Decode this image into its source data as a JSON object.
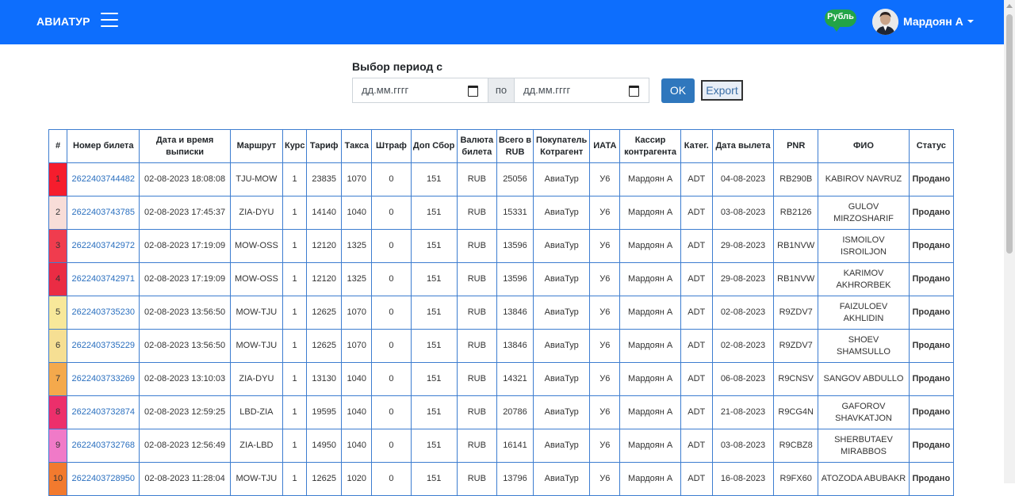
{
  "navbar": {
    "brand": "АВИАТУР",
    "currency": "Рубль",
    "user_name": "Мардоян А"
  },
  "filter": {
    "label": "Выбор период с",
    "from_placeholder": "дд.мм.гггг",
    "separator": "по",
    "to_placeholder": "дд.мм.гггг",
    "ok_label": "OK",
    "export_label": "Export"
  },
  "table": {
    "headers": [
      "#",
      "Номер билета",
      "Дата и время выписки",
      "Маршрут",
      "Курс",
      "Тариф",
      "Такса",
      "Штраф",
      "Доп Сбор",
      "Валюта билета",
      "Всего в RUB",
      "Покупатель Котрагент",
      "ИАТА",
      "Кассир контрагента",
      "Катег.",
      "Дата вылета",
      "PNR",
      "ФИО",
      "Статус"
    ],
    "rows": [
      {
        "num": "1",
        "color": "#f51d2d",
        "ticket": "2622403744482",
        "issued": "02-08-2023 18:08:08",
        "route": "TJU-MOW",
        "course": "1",
        "fare": "23835",
        "tax": "1070",
        "fine": "0",
        "extra": "151",
        "currency": "RUB",
        "total": "25056",
        "buyer": "АвиаТур",
        "iata": "У6",
        "cashier": "Мардоян А",
        "category": "ADT",
        "departure": "04-08-2023",
        "pnr": "RB290B",
        "name": "KABIROV NAVRUZ",
        "status": "Продано"
      },
      {
        "num": "2",
        "color": "#f8ddd8",
        "ticket": "2622403743785",
        "issued": "02-08-2023 17:45:37",
        "route": "ZIA-DYU",
        "course": "1",
        "fare": "14140",
        "tax": "1040",
        "fine": "0",
        "extra": "151",
        "currency": "RUB",
        "total": "15331",
        "buyer": "АвиаТур",
        "iata": "У6",
        "cashier": "Мардоян А",
        "category": "ADT",
        "departure": "03-08-2023",
        "pnr": "RB2126",
        "name": "GULOV MIRZOSHARIF",
        "status": "Продано"
      },
      {
        "num": "3",
        "color": "#f03c4e",
        "ticket": "2622403742972",
        "issued": "02-08-2023 17:19:09",
        "route": "MOW-OSS",
        "course": "1",
        "fare": "12120",
        "tax": "1325",
        "fine": "0",
        "extra": "151",
        "currency": "RUB",
        "total": "13596",
        "buyer": "АвиаТур",
        "iata": "У6",
        "cashier": "Мардоян А",
        "category": "ADT",
        "departure": "29-08-2023",
        "pnr": "RB1NVW",
        "name": "ISMOILOV ISROILJON",
        "status": "Продано"
      },
      {
        "num": "4",
        "color": "#ea2c44",
        "ticket": "2622403742971",
        "issued": "02-08-2023 17:19:09",
        "route": "MOW-OSS",
        "course": "1",
        "fare": "12120",
        "tax": "1325",
        "fine": "0",
        "extra": "151",
        "currency": "RUB",
        "total": "13596",
        "buyer": "АвиаТур",
        "iata": "У6",
        "cashier": "Мардоян А",
        "category": "ADT",
        "departure": "29-08-2023",
        "pnr": "RB1NVW",
        "name": "KARIMOV AKHRORBEK",
        "status": "Продано"
      },
      {
        "num": "5",
        "color": "#f8e89a",
        "ticket": "2622403735230",
        "issued": "02-08-2023 13:56:50",
        "route": "MOW-TJU",
        "course": "1",
        "fare": "12625",
        "tax": "1070",
        "fine": "0",
        "extra": "151",
        "currency": "RUB",
        "total": "13846",
        "buyer": "АвиаТур",
        "iata": "У6",
        "cashier": "Мардоян А",
        "category": "ADT",
        "departure": "02-08-2023",
        "pnr": "R9ZDV7",
        "name": "FAIZULOEV AKHLIDIN",
        "status": "Продано"
      },
      {
        "num": "6",
        "color": "#f6df93",
        "ticket": "2622403735229",
        "issued": "02-08-2023 13:56:50",
        "route": "MOW-TJU",
        "course": "1",
        "fare": "12625",
        "tax": "1070",
        "fine": "0",
        "extra": "151",
        "currency": "RUB",
        "total": "13846",
        "buyer": "АвиаТур",
        "iata": "У6",
        "cashier": "Мардоян А",
        "category": "ADT",
        "departure": "02-08-2023",
        "pnr": "R9ZDV7",
        "name": "SHOEV SHAMSULLO",
        "status": "Продано"
      },
      {
        "num": "7",
        "color": "#f4a94c",
        "ticket": "2622403733269",
        "issued": "02-08-2023 13:10:03",
        "route": "ZIA-DYU",
        "course": "1",
        "fare": "13130",
        "tax": "1040",
        "fine": "0",
        "extra": "151",
        "currency": "RUB",
        "total": "14321",
        "buyer": "АвиаТур",
        "iata": "У6",
        "cashier": "Мардоян А",
        "category": "ADT",
        "departure": "06-08-2023",
        "pnr": "R9CNSV",
        "name": "SANGOV ABDULLO",
        "status": "Продано"
      },
      {
        "num": "8",
        "color": "#ec2f6b",
        "ticket": "2622403732874",
        "issued": "02-08-2023 12:59:25",
        "route": "LBD-ZIA",
        "course": "1",
        "fare": "19595",
        "tax": "1040",
        "fine": "0",
        "extra": "151",
        "currency": "RUB",
        "total": "20786",
        "buyer": "АвиаТур",
        "iata": "У6",
        "cashier": "Мардоян А",
        "category": "ADT",
        "departure": "21-08-2023",
        "pnr": "R9CG4N",
        "name": "GAFOROV SHAVKATJON",
        "status": "Продано"
      },
      {
        "num": "9",
        "color": "#f07ac8",
        "ticket": "2622403732768",
        "issued": "02-08-2023 12:56:49",
        "route": "ZIA-LBD",
        "course": "1",
        "fare": "14950",
        "tax": "1040",
        "fine": "0",
        "extra": "151",
        "currency": "RUB",
        "total": "16141",
        "buyer": "АвиаТур",
        "iata": "У6",
        "cashier": "Мардоян А",
        "category": "ADT",
        "departure": "03-08-2023",
        "pnr": "R9CBZ8",
        "name": "SHERBUTAEV MIRABBOS",
        "status": "Продано"
      },
      {
        "num": "10",
        "color": "#f27a2e",
        "ticket": "2622403728950",
        "issued": "02-08-2023 11:28:04",
        "route": "MOW-TJU",
        "course": "1",
        "fare": "12625",
        "tax": "1020",
        "fine": "0",
        "extra": "151",
        "currency": "RUB",
        "total": "13796",
        "buyer": "АвиаТур",
        "iata": "У6",
        "cashier": "Мардоян А",
        "category": "ADT",
        "departure": "16-08-2023",
        "pnr": "R9FX60",
        "name": "ATOZODA ABUBAKR",
        "status": "Продано"
      }
    ]
  }
}
